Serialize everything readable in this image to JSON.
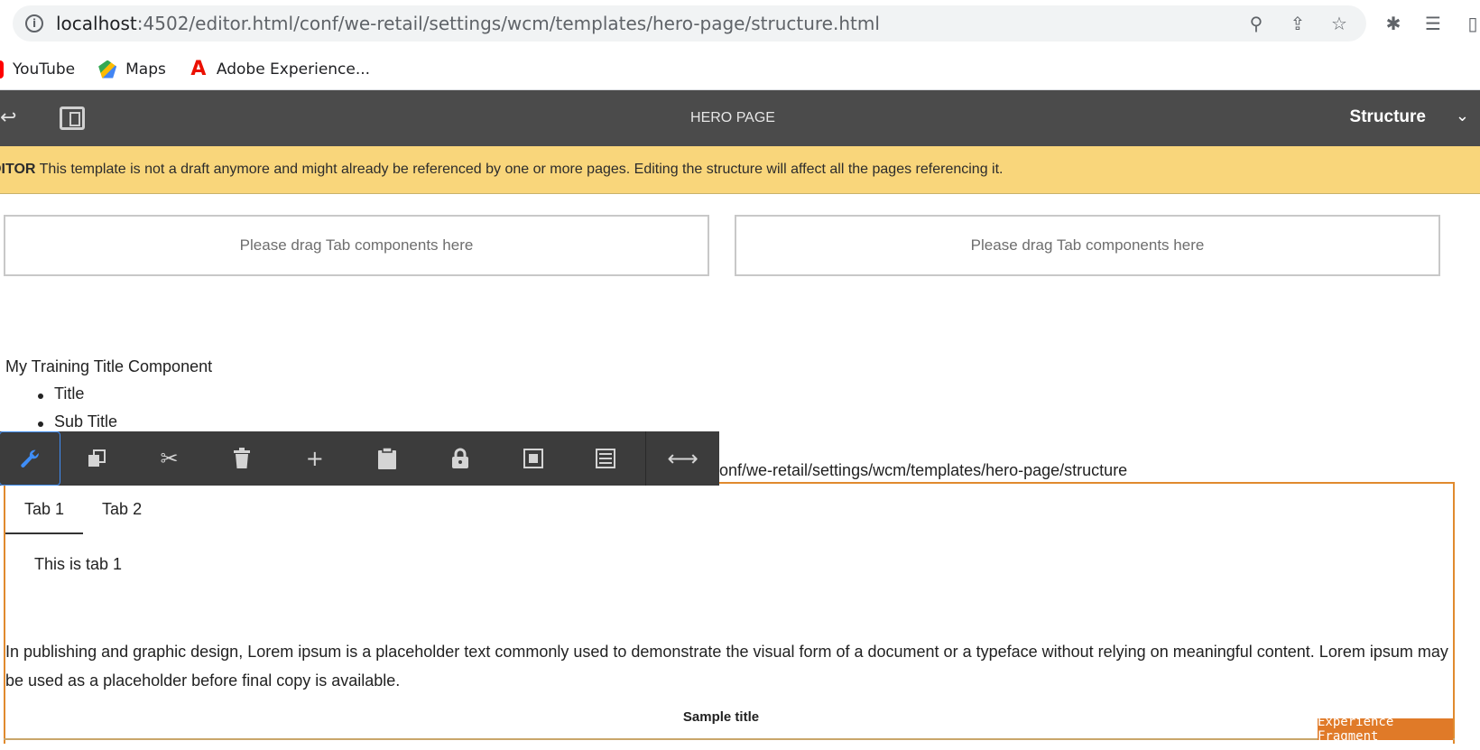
{
  "browser": {
    "url_host": "localhost",
    "url_rest": ":4502/editor.html/conf/we-retail/settings/wcm/templates/hero-page/structure.html",
    "bookmarks": [
      {
        "label": "YouTube"
      },
      {
        "label": "Maps"
      },
      {
        "label": "Adobe Experience..."
      }
    ]
  },
  "editor": {
    "page_title": "HERO PAGE",
    "mode_label": "Structure"
  },
  "banner": {
    "prefix": "DITOR",
    "message": " This template is not a draft anymore and might already be referenced by one or more pages. Editing the structure will affect all the pages referencing it."
  },
  "dropzones": [
    {
      "label": "Please drag Tab components here"
    },
    {
      "label": "Please drag Tab components here"
    }
  ],
  "title_component": {
    "heading": "My Training Title Component",
    "items": [
      "Title",
      "Sub Title"
    ]
  },
  "path_text": "onf/we-retail/settings/wcm/templates/hero-page/structure",
  "tabs": [
    {
      "label": "Tab 1",
      "active": true
    },
    {
      "label": "Tab 2",
      "active": false
    }
  ],
  "tab_content": "This is tab 1",
  "lorem_text": "In publishing and graphic design, Lorem ipsum is a placeholder text commonly used to demonstrate the visual form of a document or a typeface without relying on meaningful content. Lorem ipsum may be used as a placeholder before final copy is available.",
  "sample_title": "Sample title",
  "badge_label": "Experience Fragment",
  "toolbar_icons": [
    "wrench-icon",
    "copy-icon",
    "cut-icon",
    "delete-icon",
    "insert-icon",
    "paste-icon",
    "lock-icon",
    "frame-icon",
    "list-icon",
    "resize-icon"
  ],
  "colors": {
    "editor_bar": "#4b4b4b",
    "banner": "#f9d67b",
    "selection": "#e08a2e",
    "toolbar": "#3c3c3c",
    "active_tool": "#3f8ef8"
  }
}
